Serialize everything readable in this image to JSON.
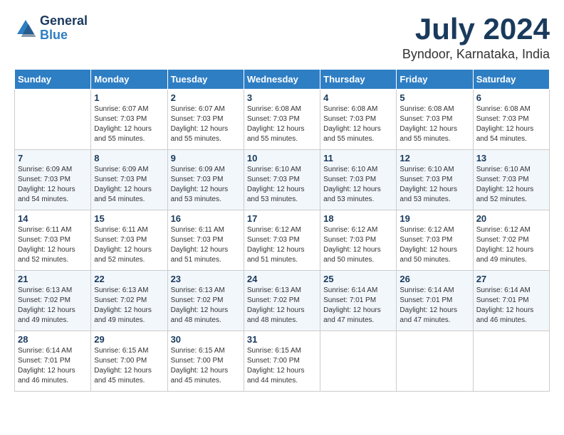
{
  "header": {
    "logo_line1": "General",
    "logo_line2": "Blue",
    "month_year": "July 2024",
    "location": "Byndoor, Karnataka, India"
  },
  "weekdays": [
    "Sunday",
    "Monday",
    "Tuesday",
    "Wednesday",
    "Thursday",
    "Friday",
    "Saturday"
  ],
  "weeks": [
    [
      {
        "day": "",
        "info": ""
      },
      {
        "day": "1",
        "info": "Sunrise: 6:07 AM\nSunset: 7:03 PM\nDaylight: 12 hours\nand 55 minutes."
      },
      {
        "day": "2",
        "info": "Sunrise: 6:07 AM\nSunset: 7:03 PM\nDaylight: 12 hours\nand 55 minutes."
      },
      {
        "day": "3",
        "info": "Sunrise: 6:08 AM\nSunset: 7:03 PM\nDaylight: 12 hours\nand 55 minutes."
      },
      {
        "day": "4",
        "info": "Sunrise: 6:08 AM\nSunset: 7:03 PM\nDaylight: 12 hours\nand 55 minutes."
      },
      {
        "day": "5",
        "info": "Sunrise: 6:08 AM\nSunset: 7:03 PM\nDaylight: 12 hours\nand 55 minutes."
      },
      {
        "day": "6",
        "info": "Sunrise: 6:08 AM\nSunset: 7:03 PM\nDaylight: 12 hours\nand 54 minutes."
      }
    ],
    [
      {
        "day": "7",
        "info": "Sunrise: 6:09 AM\nSunset: 7:03 PM\nDaylight: 12 hours\nand 54 minutes."
      },
      {
        "day": "8",
        "info": "Sunrise: 6:09 AM\nSunset: 7:03 PM\nDaylight: 12 hours\nand 54 minutes."
      },
      {
        "day": "9",
        "info": "Sunrise: 6:09 AM\nSunset: 7:03 PM\nDaylight: 12 hours\nand 53 minutes."
      },
      {
        "day": "10",
        "info": "Sunrise: 6:10 AM\nSunset: 7:03 PM\nDaylight: 12 hours\nand 53 minutes."
      },
      {
        "day": "11",
        "info": "Sunrise: 6:10 AM\nSunset: 7:03 PM\nDaylight: 12 hours\nand 53 minutes."
      },
      {
        "day": "12",
        "info": "Sunrise: 6:10 AM\nSunset: 7:03 PM\nDaylight: 12 hours\nand 53 minutes."
      },
      {
        "day": "13",
        "info": "Sunrise: 6:10 AM\nSunset: 7:03 PM\nDaylight: 12 hours\nand 52 minutes."
      }
    ],
    [
      {
        "day": "14",
        "info": "Sunrise: 6:11 AM\nSunset: 7:03 PM\nDaylight: 12 hours\nand 52 minutes."
      },
      {
        "day": "15",
        "info": "Sunrise: 6:11 AM\nSunset: 7:03 PM\nDaylight: 12 hours\nand 52 minutes."
      },
      {
        "day": "16",
        "info": "Sunrise: 6:11 AM\nSunset: 7:03 PM\nDaylight: 12 hours\nand 51 minutes."
      },
      {
        "day": "17",
        "info": "Sunrise: 6:12 AM\nSunset: 7:03 PM\nDaylight: 12 hours\nand 51 minutes."
      },
      {
        "day": "18",
        "info": "Sunrise: 6:12 AM\nSunset: 7:03 PM\nDaylight: 12 hours\nand 50 minutes."
      },
      {
        "day": "19",
        "info": "Sunrise: 6:12 AM\nSunset: 7:03 PM\nDaylight: 12 hours\nand 50 minutes."
      },
      {
        "day": "20",
        "info": "Sunrise: 6:12 AM\nSunset: 7:02 PM\nDaylight: 12 hours\nand 49 minutes."
      }
    ],
    [
      {
        "day": "21",
        "info": "Sunrise: 6:13 AM\nSunset: 7:02 PM\nDaylight: 12 hours\nand 49 minutes."
      },
      {
        "day": "22",
        "info": "Sunrise: 6:13 AM\nSunset: 7:02 PM\nDaylight: 12 hours\nand 49 minutes."
      },
      {
        "day": "23",
        "info": "Sunrise: 6:13 AM\nSunset: 7:02 PM\nDaylight: 12 hours\nand 48 minutes."
      },
      {
        "day": "24",
        "info": "Sunrise: 6:13 AM\nSunset: 7:02 PM\nDaylight: 12 hours\nand 48 minutes."
      },
      {
        "day": "25",
        "info": "Sunrise: 6:14 AM\nSunset: 7:01 PM\nDaylight: 12 hours\nand 47 minutes."
      },
      {
        "day": "26",
        "info": "Sunrise: 6:14 AM\nSunset: 7:01 PM\nDaylight: 12 hours\nand 47 minutes."
      },
      {
        "day": "27",
        "info": "Sunrise: 6:14 AM\nSunset: 7:01 PM\nDaylight: 12 hours\nand 46 minutes."
      }
    ],
    [
      {
        "day": "28",
        "info": "Sunrise: 6:14 AM\nSunset: 7:01 PM\nDaylight: 12 hours\nand 46 minutes."
      },
      {
        "day": "29",
        "info": "Sunrise: 6:15 AM\nSunset: 7:00 PM\nDaylight: 12 hours\nand 45 minutes."
      },
      {
        "day": "30",
        "info": "Sunrise: 6:15 AM\nSunset: 7:00 PM\nDaylight: 12 hours\nand 45 minutes."
      },
      {
        "day": "31",
        "info": "Sunrise: 6:15 AM\nSunset: 7:00 PM\nDaylight: 12 hours\nand 44 minutes."
      },
      {
        "day": "",
        "info": ""
      },
      {
        "day": "",
        "info": ""
      },
      {
        "day": "",
        "info": ""
      }
    ]
  ]
}
